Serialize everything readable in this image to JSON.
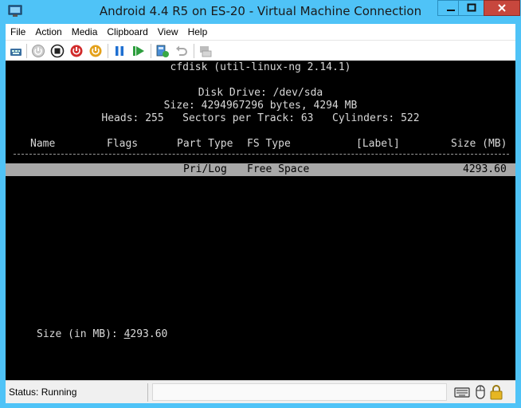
{
  "window": {
    "title": "Android 4.4 R5 on ES-20 - Virtual Machine Connection",
    "controls": {
      "minimize": "–",
      "maximize": "□",
      "close": "✕"
    }
  },
  "menu": {
    "items": [
      "File",
      "Action",
      "Media",
      "Clipboard",
      "View",
      "Help"
    ]
  },
  "toolbar": {
    "icons": [
      "ctrl-alt-del-icon",
      "start-icon",
      "turn-off-icon",
      "shutdown-icon",
      "save-state-icon",
      "pause-icon",
      "reset-icon",
      "checkpoint-icon",
      "revert-icon",
      "enhanced-session-icon"
    ]
  },
  "console": {
    "program": "cfdisk (util-linux-ng 2.14.1)",
    "disk_drive": "Disk Drive: /dev/sda",
    "size_line": "Size: 4294967296 bytes, 4294 MB",
    "geometry": "Heads: 255   Sectors per Track: 63   Cylinders: 522",
    "columns": {
      "name": "Name",
      "flags": "Flags",
      "part_type": "Part Type",
      "fs_type": "FS Type",
      "label": "[Label]",
      "size": "Size (MB)"
    },
    "partition_rows": [
      {
        "name": "",
        "flags": "",
        "part_type": "Pri/Log",
        "fs_type": "Free Space",
        "label": "",
        "size": "4293.60"
      }
    ],
    "prompt_label": "Size (in MB): ",
    "prompt_value_first": "4",
    "prompt_value_rest": "293.60"
  },
  "status": {
    "text": "Status: Running"
  },
  "colors": {
    "titlebar": "#4fc3f7",
    "console_bg": "#000000",
    "console_fg": "#d8d8d8",
    "selected_row": "#a8a8a8",
    "close_button": "#c7473d"
  }
}
